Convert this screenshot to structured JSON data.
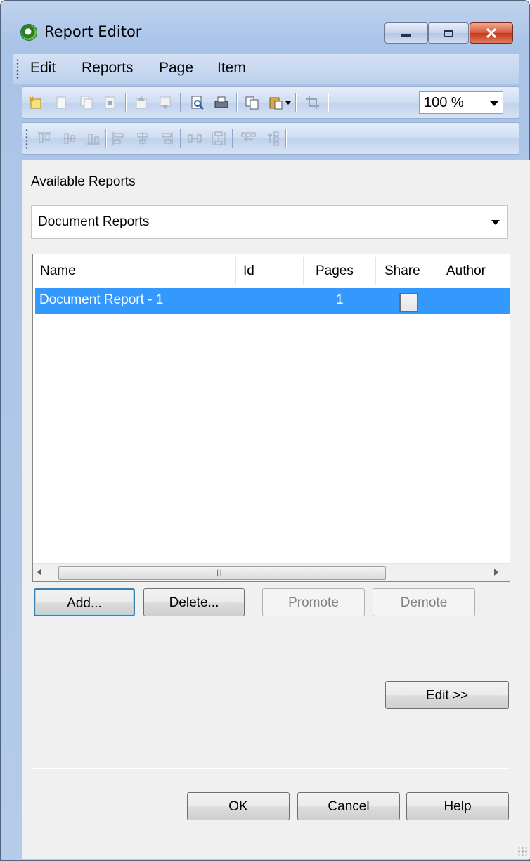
{
  "window": {
    "title": "Report Editor",
    "icon": "qlikview-icon",
    "controls": {
      "minimize": "minimize-icon",
      "maximize": "maximize-icon",
      "close": "close-icon"
    }
  },
  "menubar": {
    "items": [
      {
        "label": "Edit"
      },
      {
        "label": "Reports"
      },
      {
        "label": "Page"
      },
      {
        "label": "Item"
      }
    ]
  },
  "toolbar": {
    "zoom": "100 %",
    "row1_icons": [
      "new-report-icon",
      "copy-page-icon",
      "duplicate-page-icon",
      "delete-page-icon",
      "move-page-up-icon",
      "move-page-down-icon",
      "print-preview-icon",
      "print-icon",
      "copy-icon",
      "paste-icon",
      "crop-icon"
    ],
    "row2_icons": [
      "align-top-icon",
      "align-center-vertical-icon",
      "align-bottom-icon",
      "align-left-icon",
      "align-center-horizontal-icon",
      "align-right-icon",
      "space-horizontal-icon",
      "space-vertical-icon",
      "wrap-horizontal-icon",
      "wrap-vertical-icon"
    ]
  },
  "available_reports": {
    "label": "Available Reports",
    "selected": "Document Reports"
  },
  "table": {
    "columns": [
      "Name",
      "Id",
      "Pages",
      "Share",
      "Author"
    ],
    "rows": [
      {
        "name": "Document Report - 1",
        "id": "",
        "pages": "1",
        "share": false,
        "author": ""
      }
    ]
  },
  "buttons": {
    "add": "Add...",
    "delete": "Delete...",
    "promote": "Promote",
    "demote": "Demote",
    "edit": "Edit >>",
    "ok": "OK",
    "cancel": "Cancel",
    "help": "Help"
  },
  "colors": {
    "selection": "#3399ff",
    "title_bar": "#aac4e8",
    "close_button": "#c3371c"
  }
}
